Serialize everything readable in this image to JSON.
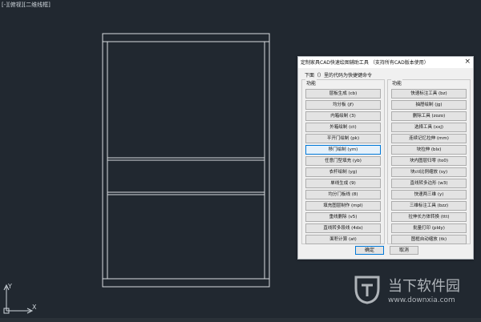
{
  "viewport": {
    "label": "[-][俯视][二维线框]"
  },
  "dialog": {
    "title": "定制家具CAD快速绘图辅助工具 （支持所有CAD版本使用）",
    "close_glyph": "×",
    "tip": "下面（）里的代码为快捷键命令",
    "group_left_label": "功能",
    "group_right_label": "功能",
    "left_buttons": [
      "层板生成 (cb)",
      "均分板 (jf)",
      "内箱绘制 (3)",
      "外箱绘制 (ct)",
      "平开门绘制 (pk)",
      "移门绘制 (ym)",
      "任意门型填充 (yb)",
      "衣杆绘制 (yg)",
      "单线生成 (9)",
      "均分门板线 (8)",
      "填充图层制作 (mpl)",
      "重线删除 (v5)",
      "直线转多段线 (4dx)",
      "面积计算 (at)"
    ],
    "right_buttons": [
      "快速标注工具 (bz)",
      "抽屉绘制 (jg)",
      "删除工具 (zozo)",
      "选择工具 (xxj)",
      "连续记忆拉伸 (mm)",
      "块拉伸 (blx)",
      "块内图层归零 (to0)",
      "块ctl比例缩放 (sy)",
      "直线转多边形 (w3)",
      "快速两三维 (y)",
      "三维标注工具 (bzz)",
      "拉伸长方体转换 (ttt)",
      "批量打印 (pldy)",
      "图框自动缩放 (tk)"
    ],
    "ok_label": "确定",
    "cancel_label": "取消"
  },
  "watermark": {
    "brand": "当下软件园",
    "url": "www.downxia.com"
  },
  "ucs": {
    "x_label": "X",
    "y_label": "Y"
  }
}
